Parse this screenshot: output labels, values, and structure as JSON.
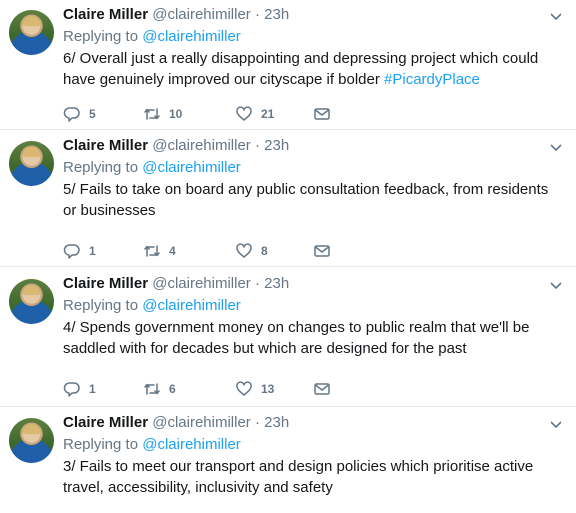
{
  "tweets": [
    {
      "name": "Claire Miller",
      "handle": "@clairehimiller",
      "dot": "·",
      "time": "23h",
      "reply_prefix": "Replying to",
      "reply_mention": "@clairehimiller",
      "text": "6/ Overall just a really disappointing and depressing project which could have genuinely improved our cityscape if bolder ",
      "hashtag": "#PicardyPlace",
      "replies": "5",
      "retweets": "10",
      "likes": "21"
    },
    {
      "name": "Claire Miller",
      "handle": "@clairehimiller",
      "dot": "·",
      "time": "23h",
      "reply_prefix": "Replying to",
      "reply_mention": "@clairehimiller",
      "text": "5/ Fails to take on board any public consultation feedback, from residents or businesses",
      "hashtag": "",
      "replies": "1",
      "retweets": "4",
      "likes": "8"
    },
    {
      "name": "Claire Miller",
      "handle": "@clairehimiller",
      "dot": "·",
      "time": "23h",
      "reply_prefix": "Replying to",
      "reply_mention": "@clairehimiller",
      "text": "4/ Spends government money on changes to public realm that we'll be saddled with for decades but which are designed for the past",
      "hashtag": "",
      "replies": "1",
      "retweets": "6",
      "likes": "13"
    },
    {
      "name": "Claire Miller",
      "handle": "@clairehimiller",
      "dot": "·",
      "time": "23h",
      "reply_prefix": "Replying to",
      "reply_mention": "@clairehimiller",
      "text": "3/ Fails to meet our transport and design policies which prioritise active travel, accessibility, inclusivity and safety",
      "hashtag": "",
      "replies": "",
      "retweets": "",
      "likes": ""
    }
  ],
  "icons": {
    "caret": "chevron-down-icon",
    "reply": "reply-icon",
    "retweet": "retweet-icon",
    "like": "heart-icon",
    "message": "envelope-icon"
  },
  "colors": {
    "link": "#1da1f2",
    "secondary": "#657786",
    "text": "#14171a",
    "divider": "#e6ecf0"
  }
}
